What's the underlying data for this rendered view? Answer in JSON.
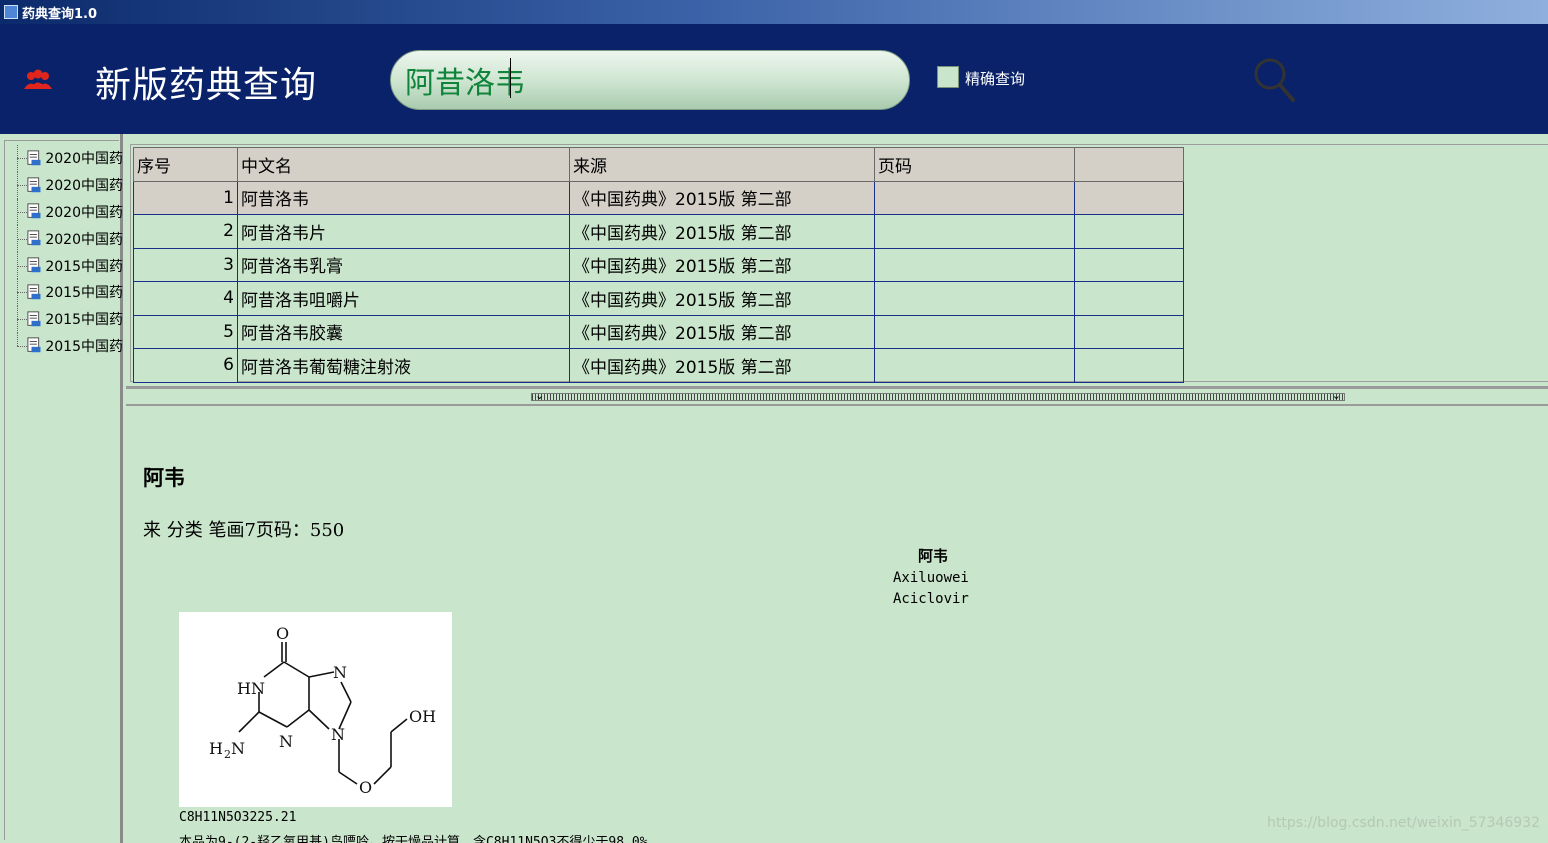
{
  "window": {
    "title": "药典查询1.0"
  },
  "header": {
    "brand": "新版药典查询",
    "search": {
      "value": "阿昔洛韦"
    },
    "exact_label": "精确查询"
  },
  "tree": {
    "items": [
      {
        "label": "2020中国药",
        "icon": "document-icon"
      },
      {
        "label": "2020中国药",
        "icon": "document-icon"
      },
      {
        "label": "2020中国药",
        "icon": "document-icon"
      },
      {
        "label": "2020中国药",
        "icon": "document-icon"
      },
      {
        "label": "2015中国药",
        "icon": "document-icon"
      },
      {
        "label": "2015中国药",
        "icon": "document-icon"
      },
      {
        "label": "2015中国药",
        "icon": "document-icon"
      },
      {
        "label": "2015中国药",
        "icon": "document-icon"
      }
    ]
  },
  "table": {
    "headers": [
      "序号",
      "中文名",
      "来源",
      "页码",
      ""
    ],
    "rows": [
      {
        "no": "1",
        "name": "阿昔洛韦",
        "source": "《中国药典》2015版 第二部",
        "page": ""
      },
      {
        "no": "2",
        "name": "阿昔洛韦片",
        "source": "《中国药典》2015版 第二部",
        "page": ""
      },
      {
        "no": "3",
        "name": "阿昔洛韦乳膏",
        "source": "《中国药典》2015版 第二部",
        "page": ""
      },
      {
        "no": "4",
        "name": "阿昔洛韦咀嚼片",
        "source": "《中国药典》2015版 第二部",
        "page": ""
      },
      {
        "no": "5",
        "name": "阿昔洛韦胶囊",
        "source": "《中国药典》2015版 第二部",
        "page": ""
      },
      {
        "no": "6",
        "name": "阿昔洛韦葡萄糖注射液",
        "source": "《中国药典》2015版 第二部",
        "page": ""
      }
    ]
  },
  "detail": {
    "title": "阿韦",
    "meta": "来 分类 笔画7页码：550",
    "name_cn": "阿韦",
    "name_pinyin": "Axiluowei",
    "name_en": "Aciclovir",
    "formula": "C8H11N5O3225.21",
    "desc": "本品为9-(2-羟乙氧甲基)鸟嘌呤。按干燥品计算，含C8H11N5O3不得少于98.0%"
  },
  "watermark": "https://blog.csdn.net/weixin_57346932",
  "colors": {
    "header_bg": "#0a2269",
    "pane_bg": "#c9e5cb",
    "selected_row": "#d4d0c8",
    "grid_border": "#1a2f8a",
    "search_text": "#10843a"
  }
}
